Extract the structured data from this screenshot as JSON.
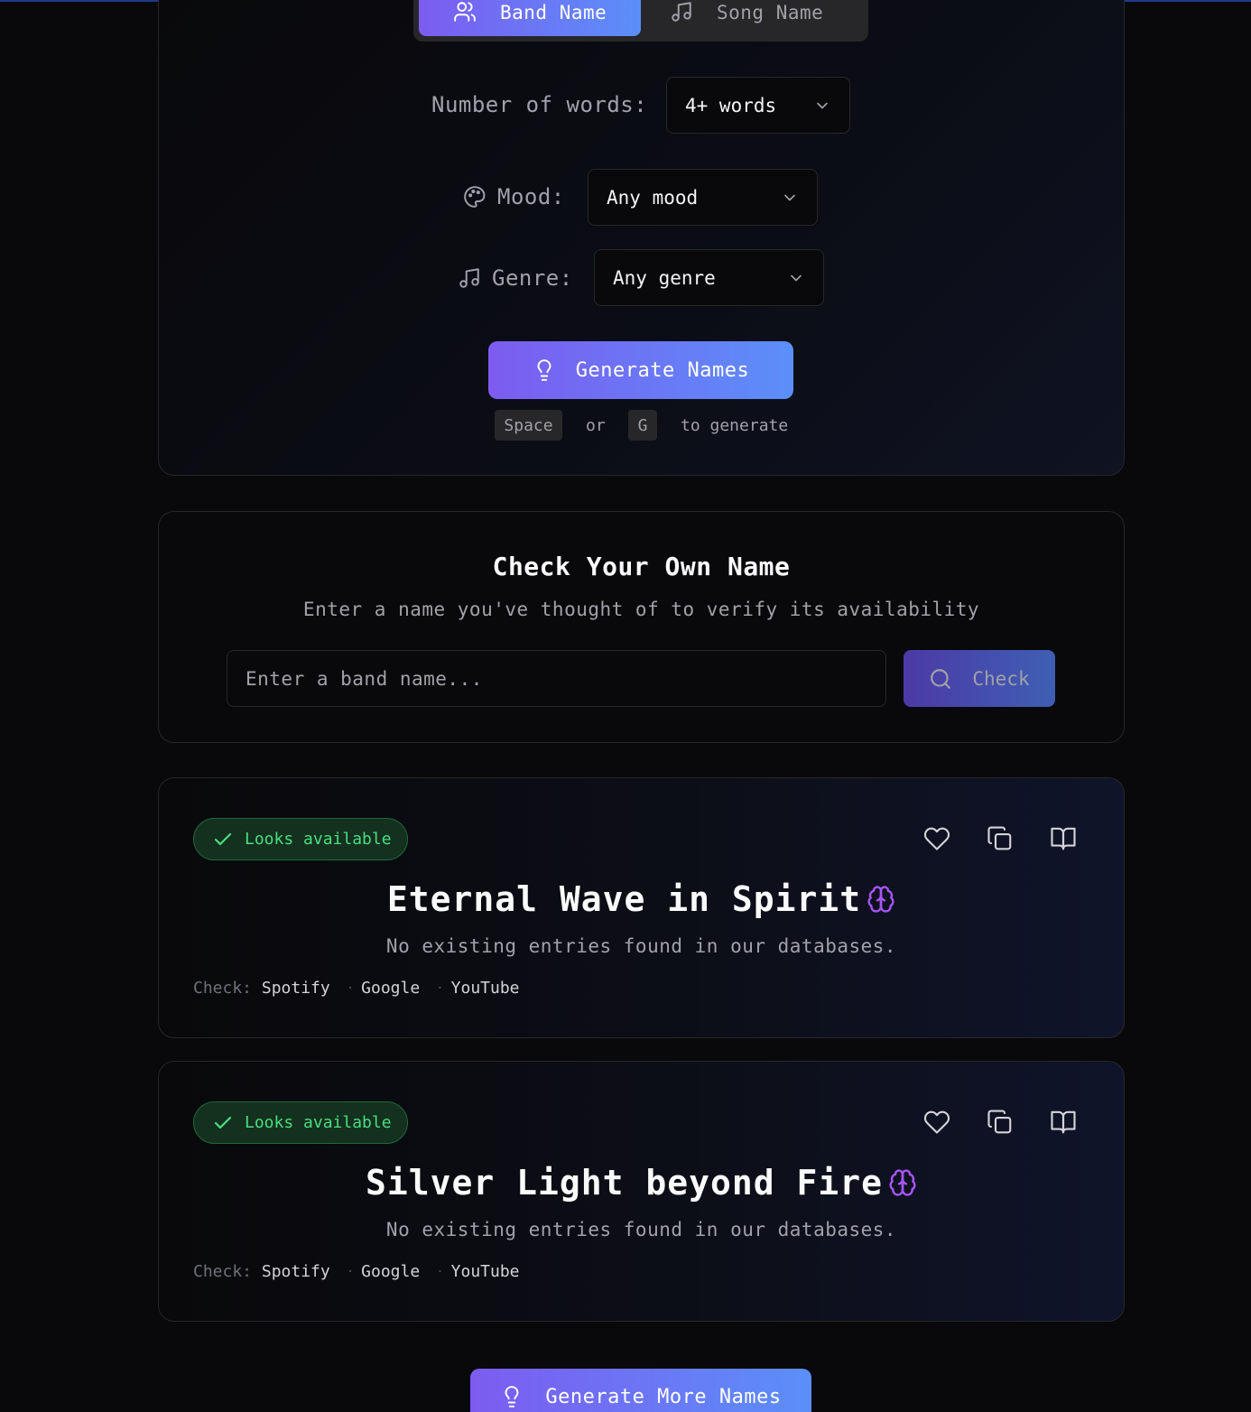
{
  "tabs": {
    "band_label": "Band Name",
    "song_label": "Song Name"
  },
  "generator": {
    "words_label": "Number of words:",
    "words_value": "4+ words",
    "mood_label": "Mood:",
    "mood_value": "Any mood",
    "genre_label": "Genre:",
    "genre_value": "Any genre",
    "generate_label": "Generate Names",
    "hint": {
      "key1": "Space",
      "or": "or",
      "key2": "G",
      "suffix": "to generate"
    }
  },
  "check_own": {
    "title": "Check Your Own Name",
    "subtitle": "Enter a name you've thought of to verify its availability",
    "input_placeholder": "Enter a band name...",
    "input_value": "",
    "button_label": "Check"
  },
  "results": [
    {
      "status": "Looks available",
      "name": "Eternal Wave in Spirit",
      "description": "No existing entries found in our databases.",
      "check_label": "Check:",
      "links": [
        "Spotify",
        "Google",
        "YouTube"
      ]
    },
    {
      "status": "Looks available",
      "name": "Silver Light beyond Fire",
      "description": "No existing entries found in our databases.",
      "check_label": "Check:",
      "links": [
        "Spotify",
        "Google",
        "YouTube"
      ]
    }
  ],
  "more_button_label": "Generate More Names",
  "colors": {
    "accent_start": "#7c5cf0",
    "accent_end": "#5b8ff9",
    "available": "#4ade80",
    "ai_icon": "#a855f7"
  }
}
